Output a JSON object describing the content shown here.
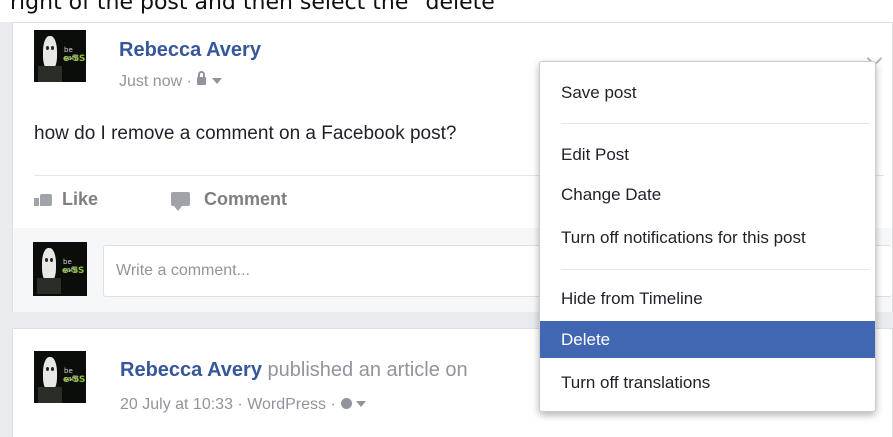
{
  "caption": "right of the post and then select the \"delete\"",
  "post1": {
    "author": "Rebecca Avery",
    "time": "Just now",
    "text": "how do I remove a comment on a Facebook post?",
    "actions": {
      "like": "Like",
      "comment": "Comment"
    },
    "comment_placeholder": "Write a comment..."
  },
  "avatar": {
    "line1": "be safe",
    "line2": "e-SS"
  },
  "post2": {
    "author": "Rebecca Avery",
    "action": "published an article on",
    "date": "20 July at 10:33",
    "source": "WordPress"
  },
  "menu": {
    "items": [
      "Save post",
      "Edit Post",
      "Change Date",
      "Turn off notifications for this post",
      "Hide from Timeline",
      "Delete",
      "Turn off translations"
    ],
    "active_index": 5
  },
  "colors": {
    "link": "#365899",
    "meta": "#90949c",
    "menu_active": "#4267b2",
    "feed_bg": "#e9ebee"
  }
}
